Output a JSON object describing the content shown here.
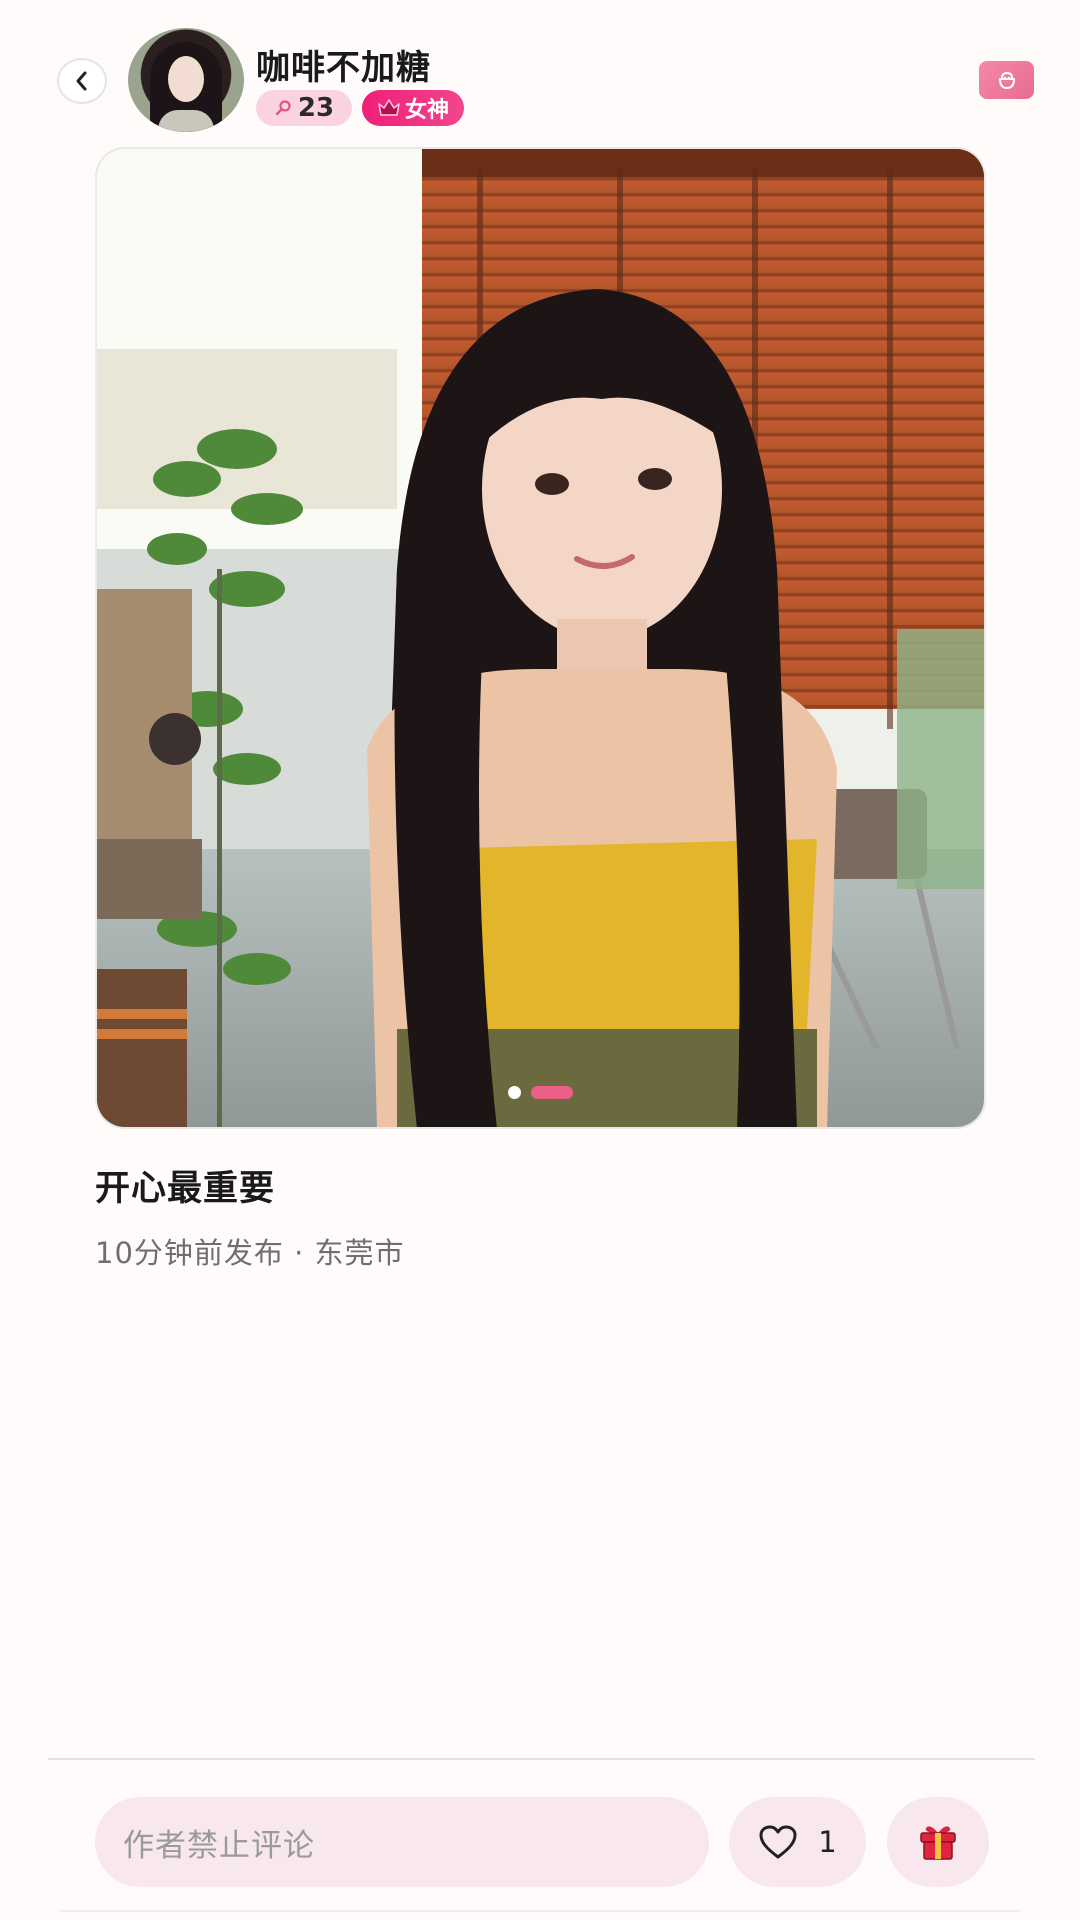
{
  "header": {
    "username": "咖啡不加糖",
    "level_value": "23",
    "vip_label": "女神",
    "icons": {
      "back": "chevron-left-icon",
      "level": "search-key-icon",
      "vip": "crown-icon",
      "top_right": "bag-icon"
    }
  },
  "photo": {
    "description_icon": "photo",
    "carousel": {
      "count": 2,
      "active_index": 1
    }
  },
  "post": {
    "title": "开心最重要",
    "meta": "10分钟前发布 · 东莞市"
  },
  "bottom_bar": {
    "comment_placeholder": "作者禁止评论",
    "like_count": "1",
    "icons": {
      "like": "heart-icon",
      "gift": "gift-icon"
    }
  },
  "colors": {
    "accent": "#ec5f86",
    "vip": "#ef1f78",
    "input_bg": "#f8e8ee"
  }
}
